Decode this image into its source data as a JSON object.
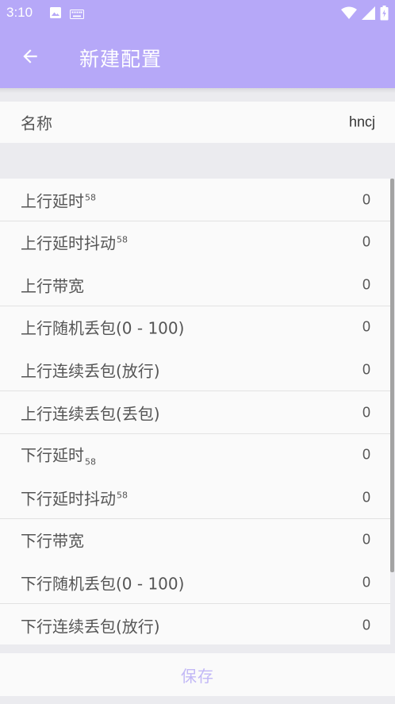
{
  "status_bar": {
    "time": "3:10",
    "icons_left": [
      "image-icon",
      "keyboard-icon"
    ],
    "icons_right": [
      "wifi-icon",
      "signal-icon",
      "battery-icon"
    ]
  },
  "header": {
    "title": "新建配置",
    "back_icon": "arrow-back-icon",
    "background": "#b6a8f8"
  },
  "name_field": {
    "label": "名称",
    "value": "hncj"
  },
  "settings": [
    {
      "label": "上行延时",
      "unit": "58",
      "unit_style": "sup",
      "value": "0"
    },
    {
      "label": "上行延时抖动",
      "unit": "58",
      "unit_style": "sup",
      "value": "0"
    },
    {
      "label": "上行带宽",
      "unit": "",
      "unit_style": "",
      "value": "0"
    },
    {
      "label": "上行随机丢包(0 - 100)",
      "unit": "",
      "unit_style": "",
      "value": "0"
    },
    {
      "label": "上行连续丢包(放行)",
      "unit": "",
      "unit_style": "",
      "value": "0"
    },
    {
      "label": "上行连续丢包(丢包)",
      "unit": "",
      "unit_style": "",
      "value": "0"
    },
    {
      "label": "下行延时",
      "unit": "58",
      "unit_style": "sub",
      "value": "0"
    },
    {
      "label": "下行延时抖动",
      "unit": "58",
      "unit_style": "sup",
      "value": "0"
    },
    {
      "label": "下行带宽",
      "unit": "",
      "unit_style": "",
      "value": "0"
    },
    {
      "label": "下行随机丢包(0 - 100)",
      "unit": "",
      "unit_style": "",
      "value": "0"
    },
    {
      "label": "下行连续丢包(放行)",
      "unit": "",
      "unit_style": "",
      "value": "0"
    }
  ],
  "save_button": {
    "label": "保存",
    "color": "#c2b8f6"
  }
}
